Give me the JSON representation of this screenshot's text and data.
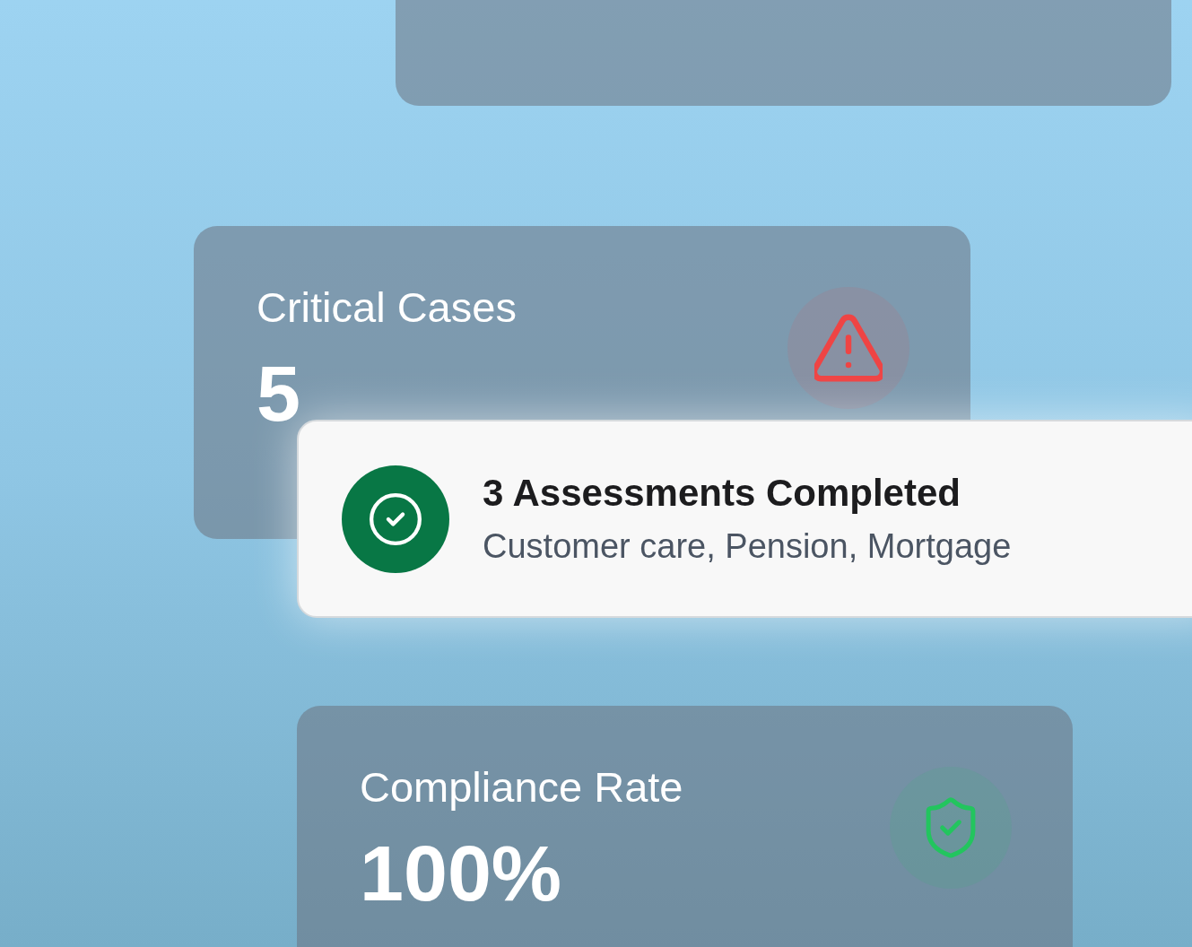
{
  "cards": [
    {
      "kind": "blank"
    },
    {
      "kind": "warning",
      "title": "Critical Cases",
      "value": "5"
    },
    {
      "kind": "success",
      "title": "Compliance Rate",
      "value": "100%"
    }
  ],
  "toast": {
    "title": "3 Assessments Completed",
    "subtitle": "Customer care, Pension, Mortgage"
  }
}
